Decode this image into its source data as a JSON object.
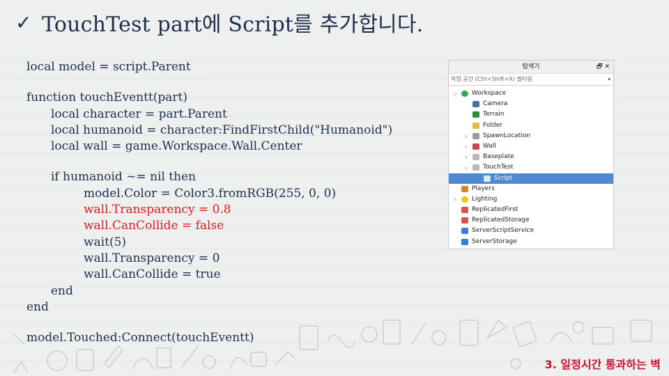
{
  "slide": {
    "title": "TouchTest part에 Script를 추가합니다.",
    "check_glyph": "✓",
    "footer": "3. 일정시간 통과하는 벽"
  },
  "code": {
    "l1": "local model = script.Parent",
    "l2": "function touchEventt(part)",
    "l3": "local character = part.Parent",
    "l4": "local humanoid = character:FindFirstChild(\"Humanoid\")",
    "l5": "local wall = game.Workspace.Wall.Center",
    "l6": "if humanoid ~= nil then",
    "l7": "model.Color = Color3.fromRGB(255, 0, 0)",
    "l8": "wall.Transparency = 0.8",
    "l9": "wall.CanCollide = false",
    "l10": "wait(5)",
    "l11": "wall.Transparency = 0",
    "l12": "wall.CanCollide = true",
    "l13": "end",
    "l14": "end",
    "l15": "model.Touched:Connect(touchEventt)"
  },
  "explorer": {
    "title": "탐색기",
    "controls": "🗗 ✕",
    "filter_placeholder": "작업 공간 (Ctrl+Shift+X) 필터링",
    "dropdown": "▾",
    "items": [
      {
        "label": "Workspace",
        "expander": "⌵",
        "icon": "globe-icon",
        "color": "#3aa25a"
      },
      {
        "label": "Camera",
        "expander": "",
        "icon": "camera-icon",
        "color": "#4a6fa5"
      },
      {
        "label": "Terrain",
        "expander": "",
        "icon": "terrain-icon",
        "color": "#2f8a3b"
      },
      {
        "label": "Folder",
        "expander": "",
        "icon": "folder-icon",
        "color": "#e8b84a"
      },
      {
        "label": "SpawnLocation",
        "expander": "›",
        "icon": "spawn-icon",
        "color": "#9a9a9a"
      },
      {
        "label": "Wall",
        "expander": "›",
        "icon": "model-icon",
        "color": "#c94a4a"
      },
      {
        "label": "Baseplate",
        "expander": "›",
        "icon": "part-icon",
        "color": "#b8b8b8"
      },
      {
        "label": "TouchTest",
        "expander": "⌵",
        "icon": "part-icon",
        "color": "#b8b8b8"
      },
      {
        "label": "Script",
        "expander": "",
        "icon": "script-icon",
        "color": "#dfe9f7"
      },
      {
        "label": "Players",
        "expander": "",
        "icon": "players-icon",
        "color": "#d9822b"
      },
      {
        "label": "Lighting",
        "expander": "›",
        "icon": "lightbulb-icon",
        "color": "#f0c419"
      },
      {
        "label": "ReplicatedFirst",
        "expander": "",
        "icon": "replicated-first-icon",
        "color": "#d9534f"
      },
      {
        "label": "ReplicatedStorage",
        "expander": "",
        "icon": "replicated-storage-icon",
        "color": "#d9534f"
      },
      {
        "label": "ServerScriptService",
        "expander": "",
        "icon": "server-script-icon",
        "color": "#3b7dd8"
      },
      {
        "label": "ServerStorage",
        "expander": "",
        "icon": "server-storage-icon",
        "color": "#3b7dd8"
      }
    ]
  }
}
